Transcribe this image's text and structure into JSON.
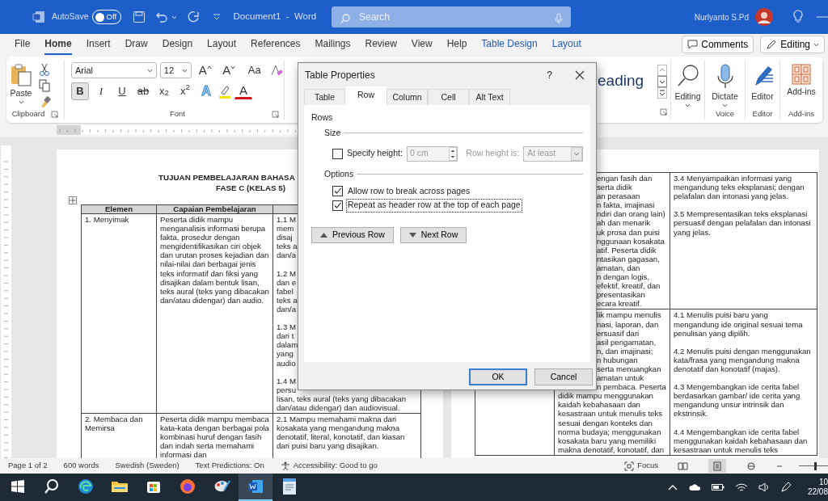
{
  "title_bar": {
    "autosave_label": "AutoSave",
    "autosave_toggle": {
      "label": "Off",
      "on": false
    },
    "document_title": "Document1  -  Word",
    "search": {
      "placeholder": "Search"
    },
    "user_name": "Nurlyanto S.Pd"
  },
  "ribbon_tabs": [
    {
      "label": "File",
      "kind": "standard",
      "selected": false
    },
    {
      "label": "Home",
      "kind": "standard",
      "selected": true
    },
    {
      "label": "Insert",
      "kind": "standard",
      "selected": false
    },
    {
      "label": "Draw",
      "kind": "standard",
      "selected": false
    },
    {
      "label": "Design",
      "kind": "standard",
      "selected": false
    },
    {
      "label": "Layout",
      "kind": "standard",
      "selected": false
    },
    {
      "label": "References",
      "kind": "standard",
      "selected": false
    },
    {
      "label": "Mailings",
      "kind": "standard",
      "selected": false
    },
    {
      "label": "Review",
      "kind": "standard",
      "selected": false
    },
    {
      "label": "View",
      "kind": "standard",
      "selected": false
    },
    {
      "label": "Help",
      "kind": "standard",
      "selected": false
    },
    {
      "label": "Table Design",
      "kind": "contextual",
      "selected": false
    },
    {
      "label": "Layout",
      "kind": "contextual",
      "selected": false
    }
  ],
  "header_buttons": [
    {
      "label": "Comments",
      "kind": "comment"
    },
    {
      "label": "Editing",
      "kind": "pencil"
    }
  ],
  "ribbon": {
    "clipboard": {
      "paste_label": "Paste",
      "group_label": "Clipboard"
    },
    "font": {
      "font_name": "Arial",
      "font_size": "12",
      "size_buttons": [
        {
          "label": "A",
          "kind": "grow"
        },
        {
          "label": "A",
          "kind": "shrink"
        }
      ],
      "change_case_label": "Aa",
      "format_buttons": [
        {
          "label": "B",
          "kind": "bold",
          "on": true
        },
        {
          "label": "I",
          "kind": "italic",
          "on": false
        },
        {
          "label": "U",
          "kind": "underline",
          "on": false
        },
        {
          "label": "ab",
          "kind": "strike",
          "on": false
        },
        {
          "label": "x$_{2}$",
          "kind": "subscript",
          "on": false
        },
        {
          "label": "x$^{2}$",
          "kind": "superscript",
          "on": false
        }
      ],
      "effects_label": "A",
      "font_color_label": "A",
      "group_label": "Font"
    },
    "styles": {
      "gallery_text": "eading"
    },
    "large_buttons": [
      {
        "kind": "search",
        "label": "Editing"
      },
      {
        "kind": "microphone",
        "label": "Dictate",
        "group_label": "Voice"
      },
      {
        "kind": "pen",
        "label": "Editor",
        "group_label": "Editor"
      },
      {
        "kind": "grid",
        "label": "Add-ins",
        "group_label": "Add-ins"
      }
    ]
  },
  "document": {
    "left_page": {
      "title_lines": [
        "TUJUAN PEMBELAJARAN BAHASA",
        "FASE C (KELAS 5)"
      ],
      "headers": [
        "Elemen",
        "Capaian Pembelajaran"
      ],
      "rows": [
        {
          "element": "1. Menyimak",
          "capaian": "Peserta didik mampu menganalisis informasi berupa fakta, prosedur dengan mengidentifikasikan ciri objek dan urutan proses kejadian dan nilai-nilai dari berbagai jenis teks informatif dan fiksi yang disajikan dalam bentuk lisan, teks aural (teks yang dibacakan dan/atau didengar) dan audio.",
          "column_3": [
            [
              "1.1 M",
              "mem",
              "disaj",
              "teks a",
              "dan/a"
            ],
            [
              "1.2 M",
              "dan e",
              "fabel",
              "teks a",
              "dan/a"
            ],
            [
              "1.3 M",
              "dari t",
              "dalam",
              "yang",
              "audio"
            ],
            [
              "1.4 M",
              "persu",
              "lisan, teks aural (teks yang dibacakan",
              "dan/atau didengar) dan audiovisual."
            ]
          ]
        },
        {
          "element": "2. Membaca dan Memirsa",
          "capaian": "Peserta didik mampu membaca kata-kata dengan berbagai pola kombinasi huruf dengan fasih dan indah serta memahami informasi dan",
          "column_3": [
            [
              "2.1 Mampu memahami makna dari kosakata yang mengandung makna denotatif, literal, konotatif, dan kiasan dari puisi baru yang disajikan."
            ]
          ]
        }
      ]
    },
    "right_page": {
      "rows": [
        {
          "column_2_partial_lines": [
            "engan fasih dan",
            "serta didik",
            "an perasaan",
            "n fakta, imajinasi",
            "ndiri dan orang lain)",
            "ah dan menarik",
            "uk prosa dan puisi",
            "nggunaan kosakata",
            "atif. Peserta didik",
            "ntasikan gagasan,",
            "amatan, dan",
            "n dengan logis,",
            "efektif, kreatif, dan",
            "presentasikan",
            "ecara kreatif."
          ],
          "column_2_lines": [],
          "column_3": [
            "3.4 Menyampaikan informasi yang mengandung teks eksplanasi; dengan pelafalan dan intonasi yang jelas.",
            "3.5 Mempresentasikan teks eksplanasi persuasif dengan pelafalan dan intonasi yang jelas."
          ]
        },
        {
          "column_2_partial_lines": [
            "lik mampu menulis",
            "nasi, laporan, dan",
            "ersuasif dari",
            "asil pengamatan,",
            "n, dan imajinasi;",
            "n hubungan",
            "serta menuangkan",
            "amatan untuk",
            "n pembaca. Peserta"
          ],
          "column_2_lines": [
            "didik mampu menggunakan",
            "kaidah kebahasaan dan",
            "kesastraan untuk menulis teks",
            "sesuai dengan konteks dan",
            "norma budaya; menggunakan",
            "kosakata baru yang memiliki",
            "makna denotatif, konotatif, dan"
          ],
          "column_3": [
            "4.1 Menulis puisi baru yang mengandung ide original sesuai tema penulisan yang dipilih.",
            "4.2 Menulis puisi dengan menggunakan kata/frasa yang mengandung makna denotatif dan konotatif (majas).",
            "4.3 Mengembangkan ide cerita fabel berdasarkan gambar/ ide cerita yang mengandung unsur intrinsik dan ekstrinsik.",
            "4.4 Mengembangkan ide cerita fabel menggunakan kaidah kebahasaan dan kesastraan untuk menulis teks"
          ]
        }
      ]
    }
  },
  "dialog": {
    "title": "Table Properties",
    "help": "?",
    "tabs": [
      {
        "label": "Table",
        "selected": false
      },
      {
        "label": "Row",
        "selected": true
      },
      {
        "label": "Column",
        "selected": false
      },
      {
        "label": "Cell",
        "selected": false
      },
      {
        "label": "Alt Text",
        "selected": false
      }
    ],
    "section": "Rows",
    "size_heading": "Size",
    "specify_height": {
      "label": "Specify height:",
      "checked": false
    },
    "height_field": {
      "value": "0 cm",
      "disabled": true
    },
    "row_height_label": "Row height is:",
    "row_height_select": {
      "value": "At least",
      "disabled": true
    },
    "options_heading": "Options",
    "options": [
      {
        "label": "Allow row to break across pages",
        "checked": true,
        "focused": false
      },
      {
        "label": "Repeat as header row at the top of each page",
        "checked": true,
        "focused": true
      }
    ],
    "nav_buttons": [
      {
        "label": "Previous Row",
        "kind": "up"
      },
      {
        "label": "Next Row",
        "kind": "down"
      }
    ],
    "buttons": [
      {
        "label": "OK",
        "default": true
      },
      {
        "label": "Cancel",
        "default": false
      }
    ]
  },
  "status_bar": {
    "items": [
      "Page 1 of 2",
      "600 words",
      "Swedish (Sweden)",
      "Text Predictions: On"
    ],
    "accessibility": "Accessibility: Good to go",
    "focus": "Focus",
    "views": [
      {
        "kind": "read",
        "selected": false
      },
      {
        "kind": "print",
        "selected": true
      },
      {
        "kind": "web",
        "selected": false
      }
    ],
    "zoom": {
      "level": 0.5
    }
  },
  "taskbar": {
    "apps": [
      {
        "kind": "start",
        "selected": false
      },
      {
        "kind": "search",
        "selected": false
      },
      {
        "kind": "edge",
        "selected": false
      },
      {
        "kind": "explorer",
        "selected": false
      },
      {
        "kind": "store",
        "selected": false
      },
      {
        "kind": "firefox",
        "selected": false
      },
      {
        "kind": "paint",
        "selected": false
      },
      {
        "kind": "word",
        "selected": true
      },
      {
        "kind": "notepad",
        "selected": false
      }
    ],
    "clock": {
      "time": "10",
      "date": "22/08"
    }
  }
}
